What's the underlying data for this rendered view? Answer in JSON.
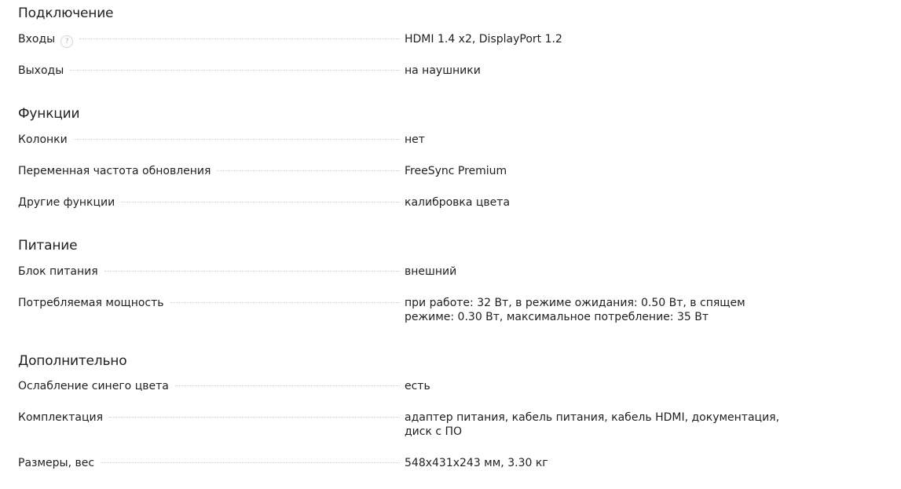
{
  "sections": [
    {
      "title": "Подключение",
      "rows": [
        {
          "label": "Входы",
          "value": "HDMI 1.4 x2, DisplayPort 1.2",
          "hint": "?"
        },
        {
          "label": "Выходы",
          "value": "на наушники"
        }
      ]
    },
    {
      "title": "Функции",
      "rows": [
        {
          "label": "Колонки",
          "value": "нет"
        },
        {
          "label": "Переменная частота обновления",
          "value": "FreeSync Premium"
        },
        {
          "label": "Другие функции",
          "value": "калибровка цвета"
        }
      ]
    },
    {
      "title": "Питание",
      "rows": [
        {
          "label": "Блок питания",
          "value": "внешний"
        },
        {
          "label": "Потребляемая мощность",
          "value": "при работе: 32 Вт, в режиме ожидания: 0.50 Вт, в спящем режиме: 0.30 Вт, максимальное потребление: 35 Вт"
        }
      ]
    },
    {
      "title": "Дополнительно",
      "rows": [
        {
          "label": "Ослабление синего цвета",
          "value": "есть"
        },
        {
          "label": "Комплектация",
          "value": "адаптер питания, кабель питания, кабель HDMI, документация, диск с ПО"
        },
        {
          "label": "Размеры, вес",
          "value": "548x431x243 мм, 3.30 кг"
        }
      ]
    }
  ]
}
